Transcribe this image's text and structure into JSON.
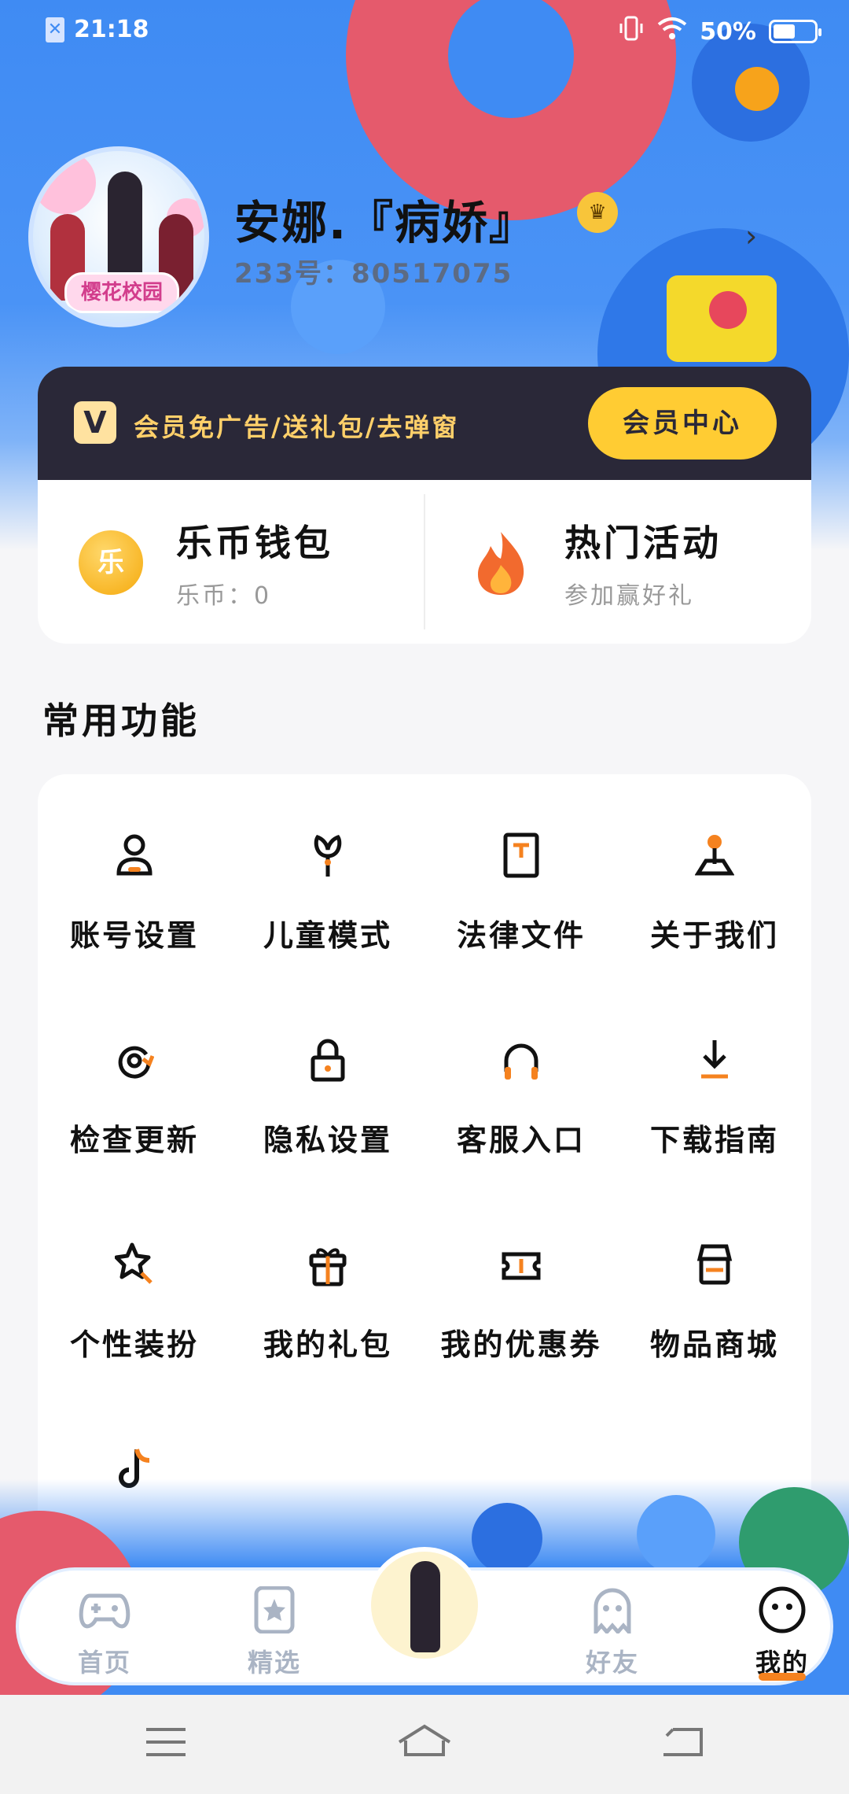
{
  "status_bar": {
    "time": "21:18",
    "battery": "50%"
  },
  "profile": {
    "avatar_badge": "樱花校园",
    "username": "安娜.『病娇』",
    "user_id": "233号：80517075"
  },
  "vip": {
    "v_icon": "V",
    "text": "会员免广告/送礼包/去弹窗",
    "button": "会员中心"
  },
  "wallet": {
    "coins": {
      "icon_text": "乐",
      "title": "乐币钱包",
      "subtitle": "乐币：0"
    },
    "events": {
      "title": "热门活动",
      "subtitle": "参加赢好礼"
    }
  },
  "section_title": "常用功能",
  "functions": [
    {
      "label": "账号设置",
      "icon": "user-icon"
    },
    {
      "label": "儿童模式",
      "icon": "sprout-icon"
    },
    {
      "label": "法律文件",
      "icon": "document-icon"
    },
    {
      "label": "关于我们",
      "icon": "joystick-icon"
    },
    {
      "label": "检查更新",
      "icon": "refresh-icon"
    },
    {
      "label": "隐私设置",
      "icon": "lock-icon"
    },
    {
      "label": "客服入口",
      "icon": "headphones-icon"
    },
    {
      "label": "下载指南",
      "icon": "download-icon"
    },
    {
      "label": "个性装扮",
      "icon": "star-brush-icon"
    },
    {
      "label": "我的礼包",
      "icon": "gift-icon"
    },
    {
      "label": "我的优惠券",
      "icon": "coupon-icon"
    },
    {
      "label": "物品商城",
      "icon": "store-icon"
    },
    {
      "label": "",
      "icon": "tiktok-icon"
    }
  ],
  "bottom_nav": [
    {
      "label": "首页",
      "icon": "gamepad-icon"
    },
    {
      "label": "精选",
      "icon": "bookmark-star-icon"
    },
    {
      "label": "好友",
      "icon": "ghost-icon"
    },
    {
      "label": "我的",
      "icon": "smiley-icon"
    }
  ],
  "colors": {
    "accent": "#f5821f",
    "vip_gold": "#ffcc33",
    "hero_blue": "#3f8bf3"
  }
}
